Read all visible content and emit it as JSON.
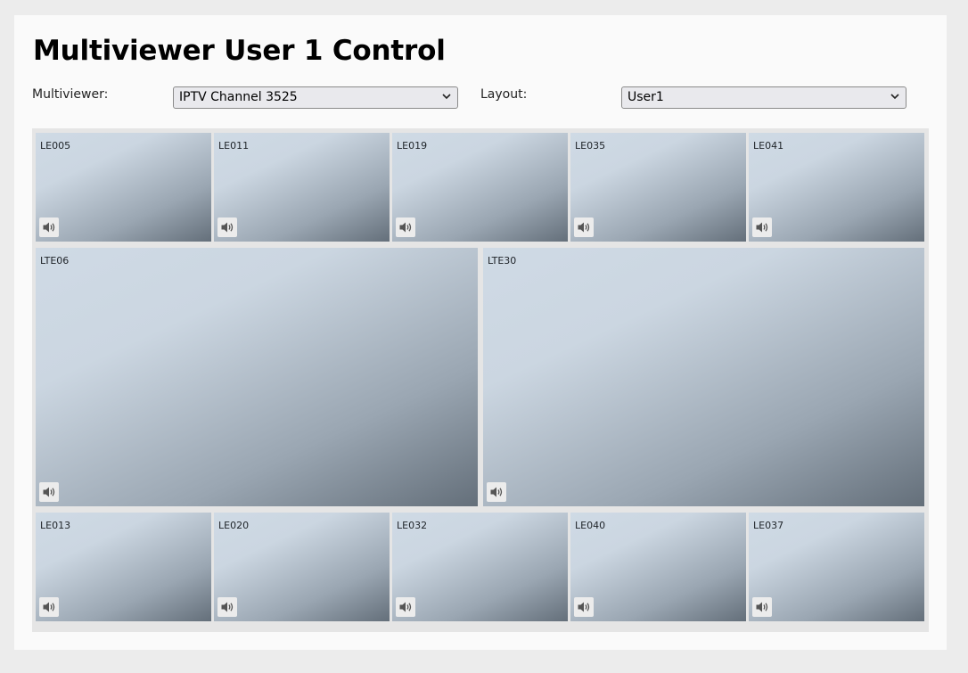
{
  "page": {
    "title": "Multiviewer User 1 Control"
  },
  "controls": {
    "multiviewer_label": "Multiviewer:",
    "multiviewer_value": "IPTV Channel 3525",
    "layout_label": "Layout:",
    "layout_value": "User1"
  },
  "tiles": {
    "top": [
      "LE005",
      "LE011",
      "LE019",
      "LE035",
      "LE041"
    ],
    "middle": [
      "LTE06",
      "LTE30"
    ],
    "bottom": [
      "LE013",
      "LE020",
      "LE032",
      "LE040",
      "LE037"
    ]
  },
  "icons": {
    "tile_audio": "speaker-volume-icon",
    "select_arrow": "chevron-down-icon"
  }
}
